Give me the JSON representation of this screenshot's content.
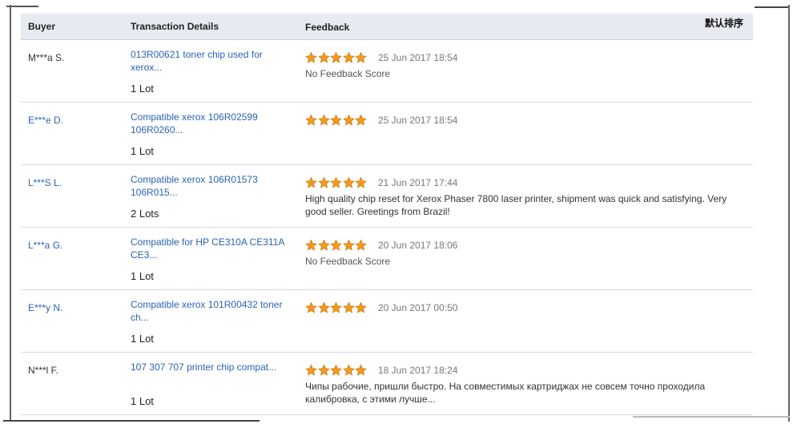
{
  "table": {
    "headers": {
      "buyer": "Buyer",
      "transaction": "Transaction Details",
      "feedback": "Feedback"
    },
    "sort_label": "默认排序",
    "star_color": "#f29a1f",
    "rows": [
      {
        "buyer": "M***a S.",
        "buyer_link": false,
        "transaction": "013R00621 toner chip used for xerox...",
        "quantity": "1 Lot",
        "rating": 5,
        "date": "25 Jun 2017 18:54",
        "comment": "No Feedback Score",
        "comment_muted": true
      },
      {
        "buyer": "E***e D.",
        "buyer_link": true,
        "transaction": "Compatible xerox 106R02599 106R0260...",
        "quantity": "1 Lot",
        "rating": 5,
        "date": "25 Jun 2017 18:54",
        "comment": "",
        "comment_muted": false
      },
      {
        "buyer": "L***S L.",
        "buyer_link": true,
        "transaction": "Compatible xerox 106R01573 106R015...",
        "quantity": "2 Lots",
        "rating": 5,
        "date": "21 Jun 2017 17:44",
        "comment": "High quality chip reset for Xerox Phaser 7800 laser printer, shipment was quick and satisfying. Very good seller. Greetings from Brazil!",
        "comment_muted": false
      },
      {
        "buyer": "L***a G.",
        "buyer_link": true,
        "transaction": "Compatible for HP CE310A CE311A CE3...",
        "quantity": "1 Lot",
        "rating": 5,
        "date": "20 Jun 2017 18:06",
        "comment": "No Feedback Score",
        "comment_muted": true
      },
      {
        "buyer": "E***y N.",
        "buyer_link": true,
        "transaction": "Compatible xerox 101R00432 toner ch...",
        "quantity": "1 Lot",
        "rating": 5,
        "date": "20 Jun 2017 00:50",
        "comment": "",
        "comment_muted": false
      },
      {
        "buyer": "N***l F.",
        "buyer_link": false,
        "transaction": "107 307 707 printer chip compat...",
        "quantity": "1 Lot",
        "rating": 5,
        "date": "18 Jun 2017 18:24",
        "comment": "Чипы рабочие, пришли быстро. На совместимых картриджах не совсем точно проходила калибровка, с этими лучше...",
        "comment_muted": false
      }
    ]
  }
}
